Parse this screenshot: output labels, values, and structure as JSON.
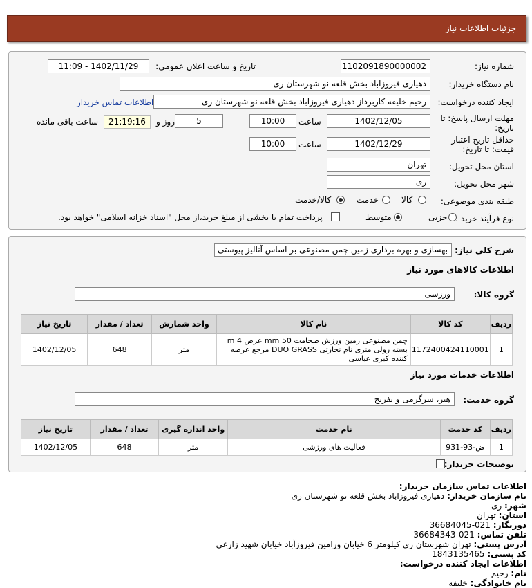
{
  "header": {
    "title": "جزئیات اطلاعات نیاز"
  },
  "form": {
    "need_number_label": "شماره نیاز:",
    "need_number": "1102091890000002",
    "announce_label": "تاریخ و ساعت اعلان عمومی:",
    "announce_value": "1402/11/29 - 11:09",
    "buyer_label": "نام دستگاه خریدار:",
    "buyer_value": "دهیاری فیروزاباد بخش قلعه نو شهرستان ری",
    "creator_label": "ایجاد کننده درخواست:",
    "creator_value": "رحیم خلیفه کاربرداز دهیاری فیروزاباد بخش قلعه نو شهرستان ری",
    "contact_link": "اطلاعات تماس خریدار",
    "deadline_label_1": "مهلت ارسال پاسخ: تا",
    "deadline_label_2": "تاریخ:",
    "deadline_date": "1402/12/05",
    "time_label": "ساعت",
    "deadline_time": "10:00",
    "days_value": "5",
    "days_label": "روز و",
    "remaining_time": "21:19:16",
    "remaining_label": "ساعت باقی مانده",
    "validity_label_1": "حداقل تاریخ اعتبار",
    "validity_label_2": "قیمت: تا تاریخ:",
    "validity_date": "1402/12/29",
    "validity_time": "10:00",
    "province_label": "استان محل تحویل:",
    "province_value": "تهران",
    "city_label": "شهر محل تحویل:",
    "city_value": "ری",
    "category_label": "طبقه بندی موضوعی:",
    "category_options": [
      "کالا",
      "خدمت",
      "کالا/خدمت"
    ],
    "purchase_label": "نوع فرآیند خرید :",
    "purchase_options": [
      "جزیی",
      "متوسط"
    ],
    "treasury_note": "پرداخت تمام یا بخشی از مبلغ خرید،از محل \"اسناد خزانه اسلامی\" خواهد بود."
  },
  "description": {
    "label": "شرح کلی نیاز:",
    "value": "بهسازی و بهره برداری زمین چمن مصنوعی بر اساس آنالیز پیوستی"
  },
  "goods": {
    "section_title": "اطلاعات کالاهای مورد نیاز",
    "group_label": "گروه کالا:",
    "group_value": "ورزشی",
    "headers": [
      "ردیف",
      "کد کالا",
      "نام کالا",
      "واحد شمارش",
      "تعداد / مقدار",
      "تاریخ نیاز"
    ],
    "rows": [
      {
        "row": "1",
        "code": "1172400424110001",
        "name": "چمن مصنوعی زمین ورزش ضخامت mm 50 عرض m 4 بسته رولی متری نام تجارتی DUO GRASS مرجع عرضه کننده کبری عباسی",
        "unit": "متر",
        "qty": "648",
        "date": "1402/12/05"
      }
    ]
  },
  "services": {
    "section_title": "اطلاعات خدمات مورد نیاز",
    "group_label": "گروه خدمت:",
    "group_value": "هنر، سرگرمی و تفریح",
    "headers": [
      "ردیف",
      "کد خدمت",
      "نام خدمت",
      "واحد اندازه گیری",
      "تعداد / مقدار",
      "تاریخ نیاز"
    ],
    "rows": [
      {
        "row": "1",
        "code": "ض-93-931",
        "name": "فعالیت های ورزشی",
        "unit": "متر",
        "qty": "648",
        "date": "1402/12/05"
      }
    ]
  },
  "notes_label": "توضیحات خریدار:",
  "contact": {
    "title": "اطلاعات تماس سازمان خریدار:",
    "org_label": "نام سازمان خریدار:",
    "org_value": "دهیاری فیروزاباد بخش قلعه نو شهرستان ری",
    "city_label": "شهر:",
    "city_value": "ری",
    "province_label": "استان:",
    "province_value": "تهران",
    "fax_label": "دورنگار:",
    "fax_value": "021-36684045",
    "phone_label": "تلفن تماس:",
    "phone_value": "021-36684343",
    "address_label": "آدرس پستی:",
    "address_value": "تهران شهرستان ری کیلومتر 6 خیابان ورامین فیروزآباد خیابان شهید زارعی",
    "postal_label": "کد پستی:",
    "postal_value": "1843135465",
    "creator_title": "اطلاعات ایجاد کننده درخواست:",
    "name_label": "نام:",
    "name_value": "رحیم",
    "family_label": "نام خانوادگی:",
    "family_value": "خلیفه"
  },
  "colors": {
    "header_bg": "#9a3a22",
    "link": "#1a3fa0",
    "panel_bg": "#f4f4f4",
    "table_header": "#d9d9d9"
  }
}
